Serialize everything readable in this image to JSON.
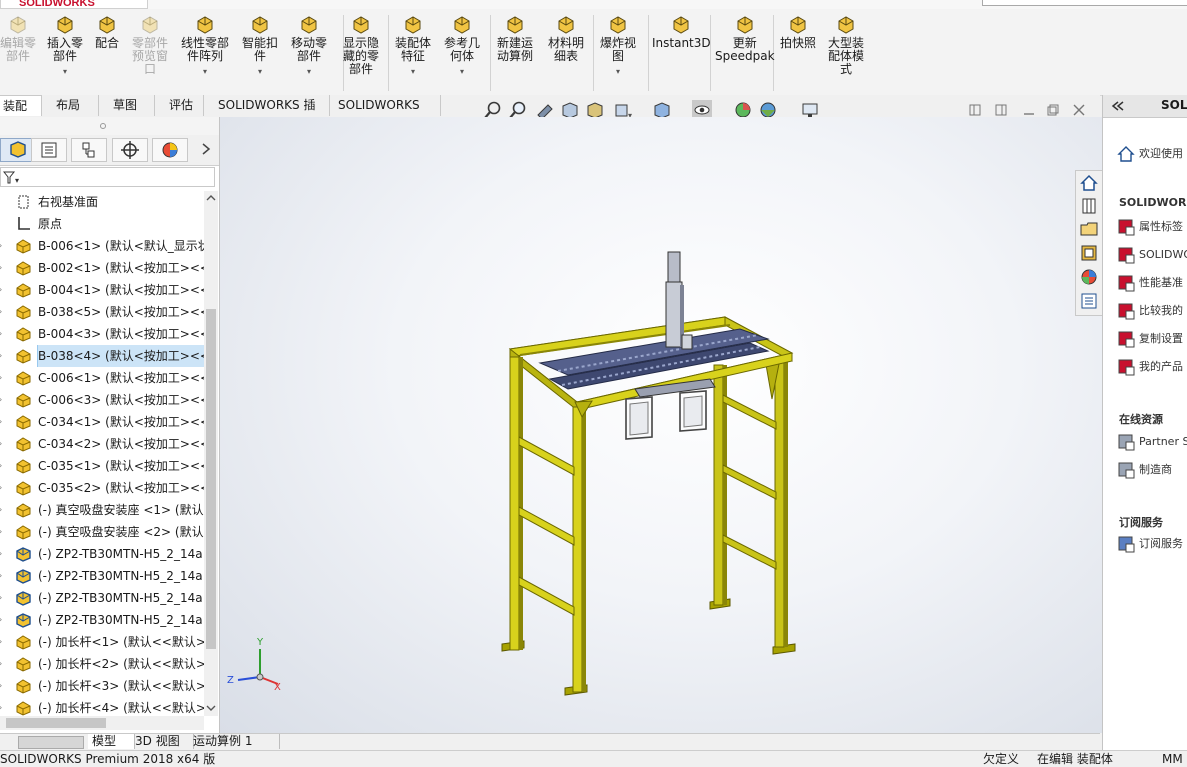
{
  "app": {
    "brand": "SOLIDWORKS"
  },
  "ribbon": {
    "buttons": [
      {
        "label": "编辑零\n部件",
        "disabled": true
      },
      {
        "label": "插入零\n部件",
        "disabled": false
      },
      {
        "label": "配合",
        "disabled": false
      },
      {
        "label": "零部件\n预览窗\n口",
        "disabled": true
      },
      {
        "label": "线性零部\n件阵列",
        "disabled": false
      },
      {
        "label": "智能扣\n件",
        "disabled": false
      },
      {
        "label": "移动零\n部件",
        "disabled": false
      },
      {
        "label": "显示隐\n藏的零\n部件",
        "disabled": false
      },
      {
        "label": "装配体\n特征",
        "disabled": false
      },
      {
        "label": "参考几\n何体",
        "disabled": false
      },
      {
        "label": "新建运\n动算例",
        "disabled": false
      },
      {
        "label": "材料明\n细表",
        "disabled": false
      },
      {
        "label": "爆炸视\n图",
        "disabled": false
      },
      {
        "label": "Instant3D",
        "disabled": false
      },
      {
        "label": "更新\nSpeedpak",
        "disabled": false
      },
      {
        "label": "拍快照",
        "disabled": false
      },
      {
        "label": "大型装\n配体模\n式",
        "disabled": false
      }
    ]
  },
  "command_tabs": [
    "装配体",
    "布局",
    "草图",
    "评估",
    "SOLIDWORKS 插件",
    "SOLIDWORKS MBD"
  ],
  "feature_tree": {
    "items": [
      {
        "label": "右视基准面",
        "icon": "plane-icon",
        "arrow": false,
        "selected": false
      },
      {
        "label": "原点",
        "icon": "origin-icon",
        "arrow": false,
        "selected": false
      },
      {
        "label": "B-006<1> (默认<默认_显示状",
        "icon": "part-icon",
        "arrow": true,
        "selected": false
      },
      {
        "label": "B-002<1> (默认<按加工><<",
        "icon": "part-icon",
        "arrow": true,
        "selected": false
      },
      {
        "label": "B-004<1> (默认<按加工><<",
        "icon": "part-icon",
        "arrow": true,
        "selected": false
      },
      {
        "label": "B-038<5> (默认<按加工><<",
        "icon": "part-icon",
        "arrow": true,
        "selected": false
      },
      {
        "label": "B-004<3> (默认<按加工><<",
        "icon": "part-icon",
        "arrow": true,
        "selected": false
      },
      {
        "label": "B-038<4> (默认<按加工><<",
        "icon": "part-icon",
        "arrow": true,
        "selected": true
      },
      {
        "label": "C-006<1> (默认<按加工><<",
        "icon": "part-icon",
        "arrow": true,
        "selected": false
      },
      {
        "label": "C-006<3> (默认<按加工><<",
        "icon": "part-icon",
        "arrow": true,
        "selected": false
      },
      {
        "label": "C-034<1> (默认<按加工><<",
        "icon": "part-icon",
        "arrow": true,
        "selected": false
      },
      {
        "label": "C-034<2> (默认<按加工><<",
        "icon": "part-icon",
        "arrow": true,
        "selected": false
      },
      {
        "label": "C-035<1> (默认<按加工><<",
        "icon": "part-icon",
        "arrow": true,
        "selected": false
      },
      {
        "label": "C-035<2> (默认<按加工><<",
        "icon": "part-icon",
        "arrow": true,
        "selected": false
      },
      {
        "label": "(-) 真空吸盘安装座 <1> (默认",
        "icon": "part-icon",
        "arrow": true,
        "selected": false
      },
      {
        "label": "(-) 真空吸盘安装座 <2> (默认",
        "icon": "part-icon",
        "arrow": true,
        "selected": false
      },
      {
        "label": "(-) ZP2-TB30MTN-H5_2_14a",
        "icon": "assembly-icon",
        "arrow": true,
        "selected": false
      },
      {
        "label": "(-) ZP2-TB30MTN-H5_2_14a",
        "icon": "assembly-icon",
        "arrow": true,
        "selected": false
      },
      {
        "label": "(-) ZP2-TB30MTN-H5_2_14a",
        "icon": "assembly-icon",
        "arrow": true,
        "selected": false
      },
      {
        "label": "(-) ZP2-TB30MTN-H5_2_14a",
        "icon": "assembly-icon",
        "arrow": true,
        "selected": false
      },
      {
        "label": "(-) 加长杆<1> (默认<<默认>_",
        "icon": "part-icon",
        "arrow": true,
        "selected": false
      },
      {
        "label": "(-) 加长杆<2> (默认<<默认>_",
        "icon": "part-icon",
        "arrow": true,
        "selected": false
      },
      {
        "label": "(-) 加长杆<3> (默认<<默认>_",
        "icon": "part-icon",
        "arrow": true,
        "selected": false
      },
      {
        "label": "(-) 加长杆<4> (默认<<默认>",
        "icon": "part-icon",
        "arrow": true,
        "selected": false
      }
    ]
  },
  "triad": {
    "y": "Y",
    "z": "Z",
    "x": "X"
  },
  "bottom_tabs": [
    "模型",
    "3D 视图",
    "运动算例 1"
  ],
  "status": {
    "product": "SOLIDWORKS Premium 2018 x64 版",
    "definition": "欠定义",
    "mode": "在编辑 装配体",
    "units": "MM"
  },
  "taskpane": {
    "header": "SOLI",
    "welcome": "欢迎使用",
    "section_tools": "SOLIDWORKS",
    "tools": [
      "属性标签",
      "SOLIDWO",
      "性能基准",
      "比较我的",
      "复制设置",
      "我的产品"
    ],
    "section_online": "在线资源",
    "online": [
      "Partner S",
      "制造商"
    ],
    "section_sub": "订阅服务",
    "sub": [
      "订阅服务"
    ]
  },
  "colors": {
    "frame": "#c9c418",
    "frame_dark": "#7a7605",
    "rail": "#3e4870",
    "accent": "#1e90ff",
    "selection": "#cce4f7"
  }
}
